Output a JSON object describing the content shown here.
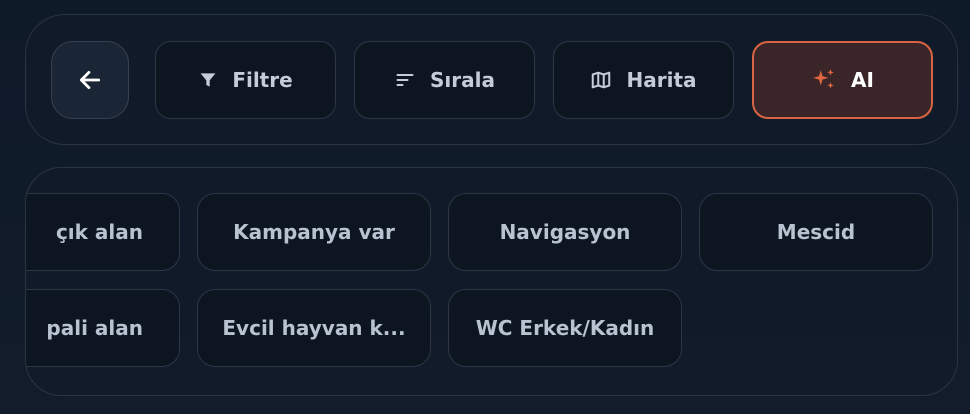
{
  "toolbar": {
    "back_icon": "arrow-left-icon",
    "filter": {
      "label": "Filtre",
      "icon": "funnel-icon"
    },
    "sort": {
      "label": "Sırala",
      "icon": "sort-lines-icon"
    },
    "map": {
      "label": "Harita",
      "icon": "map-icon"
    },
    "ai": {
      "label": "AI",
      "icon": "sparkles-icon",
      "accent": "#d76444"
    }
  },
  "chips": {
    "row1": [
      "çık alan",
      "Kampanya var",
      "Navigasyon",
      "Mescid"
    ],
    "row2": [
      "pali alan",
      "Evcil hayvan k...",
      "WC Erkek/Kadın"
    ]
  },
  "colors": {
    "background": "#101a28",
    "button_bg": "#0c1520",
    "border": "#2c3646",
    "text": "#c4ccd8"
  }
}
